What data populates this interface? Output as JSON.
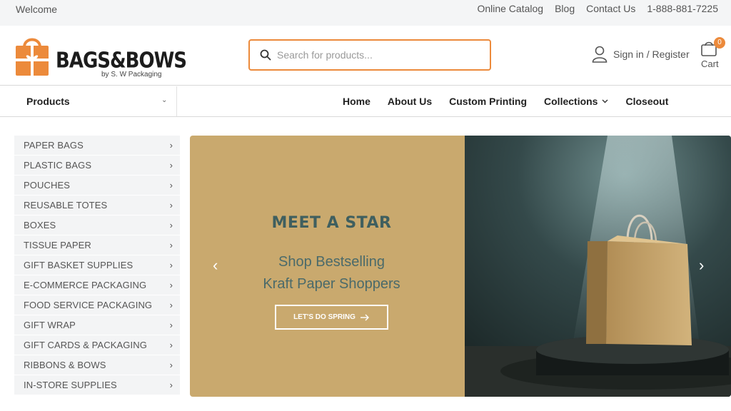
{
  "topbar": {
    "welcome": "Welcome",
    "links": [
      "Online Catalog",
      "Blog",
      "Contact Us",
      "1-888-881-7225"
    ]
  },
  "logo": {
    "brand": "BAGS&BOWS",
    "byline": "by S. W Packaging"
  },
  "search": {
    "placeholder": "Search for products..."
  },
  "account": {
    "label": "Sign in / Register"
  },
  "cart": {
    "label": "Cart",
    "count": "0"
  },
  "nav": {
    "products_label": "Products",
    "items": [
      "Home",
      "About Us",
      "Custom Printing",
      "Collections",
      "Closeout"
    ]
  },
  "categories": [
    "PAPER BAGS",
    "PLASTIC BAGS",
    "POUCHES",
    "REUSABLE TOTES",
    "BOXES",
    "TISSUE PAPER",
    "GIFT BASKET SUPPLIES",
    "E-COMMERCE PACKAGING",
    "FOOD SERVICE PACKAGING",
    "GIFT WRAP",
    "GIFT CARDS & PACKAGING",
    "RIBBONS & BOWS",
    "IN-STORE SUPPLIES"
  ],
  "hero": {
    "headline": "MEET A STAR",
    "sub_line1": "Shop Bestselling",
    "sub_line2": "Kraft Paper Shoppers",
    "cta": "LET'S DO SPRING"
  },
  "colors": {
    "accent": "#ec8a3b",
    "hero_tan": "#c9a96e",
    "hero_text": "#3f5f5f"
  }
}
